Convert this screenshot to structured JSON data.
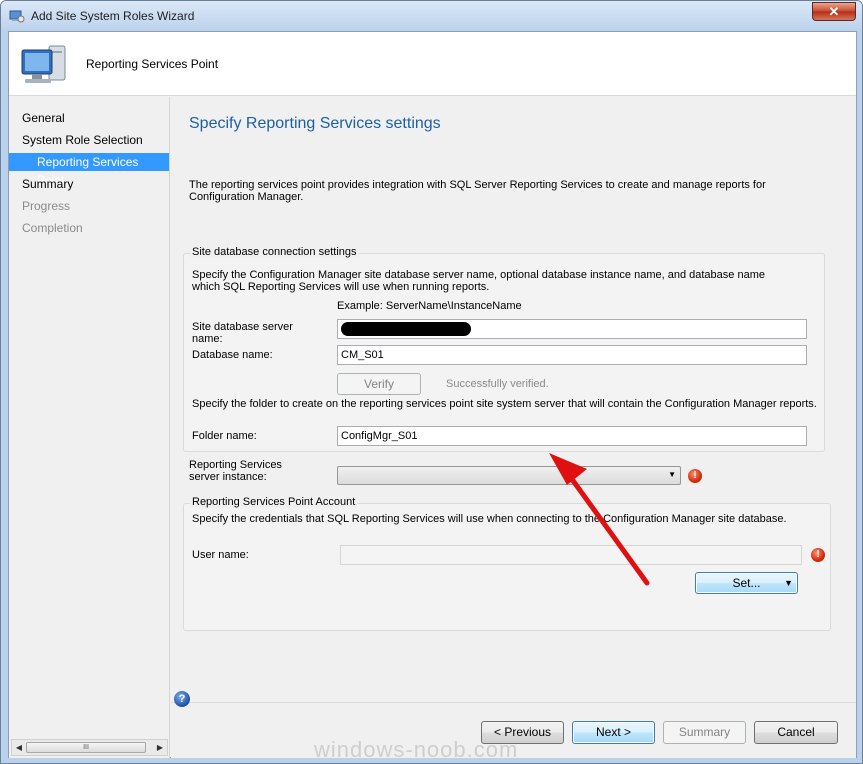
{
  "window": {
    "title": "Add Site System Roles Wizard",
    "close_glyph": "✕"
  },
  "header": {
    "title": "Reporting Services Point"
  },
  "nav": {
    "items": [
      {
        "label": "General",
        "state": "normal"
      },
      {
        "label": "System Role Selection",
        "state": "normal"
      },
      {
        "label": "Reporting Services Point",
        "state": "active"
      },
      {
        "label": "Summary",
        "state": "normal"
      },
      {
        "label": "Progress",
        "state": "disabled"
      },
      {
        "label": "Completion",
        "state": "disabled"
      }
    ],
    "scroll_thumb_glyph": "III",
    "scroll_left_glyph": "◀",
    "scroll_right_glyph": "▶"
  },
  "main": {
    "title": "Specify Reporting Services settings",
    "description": "The reporting services point provides integration with SQL Server Reporting Services to create and manage reports for Configuration Manager.",
    "db_group": {
      "title": "Site database connection settings",
      "instructions": "Specify the Configuration Manager site database server name, optional database instance name, and database name  which SQL Reporting Services will use when running reports.",
      "example": "Example: ServerName\\InstanceName",
      "server_label": "Site database server name:",
      "server_value": "",
      "database_label": "Database name:",
      "database_value": "CM_S01",
      "verify_label": "Verify",
      "verified_text": "Successfully verified.",
      "folder_instructions": "Specify the folder to create on the reporting services point site system server that will contain the Configuration Manager reports.",
      "folder_label": "Folder name:",
      "folder_value": "ConfigMgr_S01"
    },
    "instance": {
      "label": "Reporting Services server instance:",
      "value": "",
      "dropdown_glyph": "▼",
      "error_glyph": "!"
    },
    "account_group": {
      "title": "Reporting Services Point Account",
      "instructions": "Specify the credentials that SQL Reporting Services will use when connecting to the Configuration Manager site database.",
      "user_label": "User name:",
      "user_value": "",
      "error_glyph": "!",
      "set_label": "Set...",
      "set_glyph": "▼"
    }
  },
  "footer": {
    "help_glyph": "?",
    "previous_label": "< Previous",
    "next_label": "Next >",
    "summary_label": "Summary",
    "cancel_label": "Cancel"
  },
  "watermark": "windows-noob.com",
  "colors": {
    "accent_title": "#1d5fa8",
    "nav_active": "#3399ff",
    "annotation_arrow": "#e01010",
    "error": "#d32b09"
  }
}
